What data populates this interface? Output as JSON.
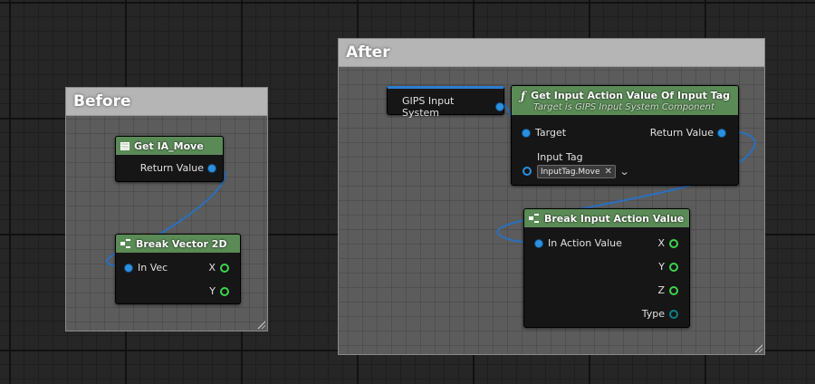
{
  "comments": {
    "before": {
      "title": "Before"
    },
    "after": {
      "title": "After"
    }
  },
  "nodes": {
    "get_ia_move": {
      "title": "Get IA_Move",
      "return_label": "Return Value"
    },
    "break_vector": {
      "title": "Break Vector 2D",
      "in_label": "In Vec",
      "x_label": "X",
      "y_label": "Y"
    },
    "gips_system": {
      "title": "GIPS Input System"
    },
    "get_input_action": {
      "title": "Get Input Action Value Of Input Tag",
      "subtitle": "Target is GIPS Input System Component",
      "target_label": "Target",
      "return_label": "Return Value",
      "input_tag_label": "Input Tag",
      "input_tag_value": "InputTag.Move"
    },
    "break_input_action": {
      "title": "Break Input Action Value",
      "in_label": "In Action Value",
      "x_label": "X",
      "y_label": "Y",
      "z_label": "Z",
      "type_label": "Type"
    }
  },
  "colors": {
    "node_header": "#5a8a56",
    "struct_pin": "#2a90e0",
    "float_pin": "#3ed34d",
    "enum_pin": "#0d7f85",
    "wire": "#2a6fc0"
  },
  "icons": {
    "function": "function-f-icon",
    "variable": "variable-grid-icon",
    "break": "break-struct-icon",
    "clear": "close-icon",
    "dropdown": "chevron-down-icon"
  }
}
